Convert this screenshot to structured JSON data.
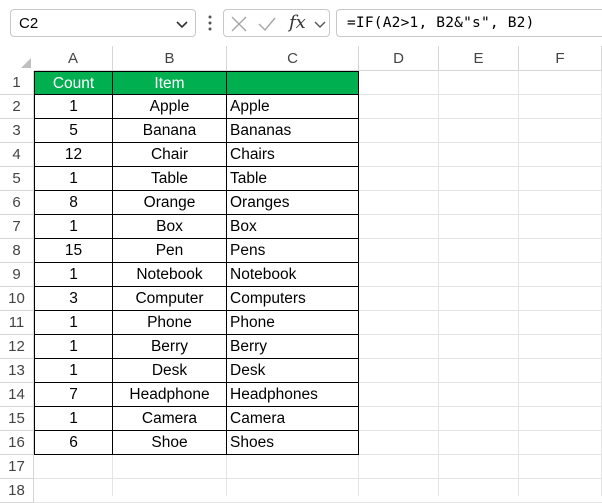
{
  "formula_bar": {
    "name_box": "C2",
    "fx_label": "fx",
    "formula": "=IF(A2>1, B2&\"s\", B2)",
    "icons": [
      "chevron-down-icon",
      "more-options-icon",
      "cancel-icon",
      "enter-icon",
      "function-icon"
    ]
  },
  "columns": [
    "A",
    "B",
    "C",
    "D",
    "E",
    "F"
  ],
  "rows": [
    "1",
    "2",
    "3",
    "4",
    "5",
    "6",
    "7",
    "8",
    "9",
    "10",
    "11",
    "12",
    "13",
    "14",
    "15",
    "16",
    "17",
    "18"
  ],
  "table": {
    "header": [
      "Count",
      "Item",
      ""
    ],
    "header_fill": "#00b050",
    "header_text_color": "#ffffff",
    "rows": [
      [
        "1",
        "Apple",
        "Apple"
      ],
      [
        "5",
        "Banana",
        "Bananas"
      ],
      [
        "12",
        "Chair",
        "Chairs"
      ],
      [
        "1",
        "Table",
        "Table"
      ],
      [
        "8",
        "Orange",
        "Oranges"
      ],
      [
        "1",
        "Box",
        "Box"
      ],
      [
        "15",
        "Pen",
        "Pens"
      ],
      [
        "1",
        "Notebook",
        "Notebook"
      ],
      [
        "3",
        "Computer",
        "Computers"
      ],
      [
        "1",
        "Phone",
        "Phone"
      ],
      [
        "1",
        "Berry",
        "Berry"
      ],
      [
        "1",
        "Desk",
        "Desk"
      ],
      [
        "7",
        "Headphone",
        "Headphones"
      ],
      [
        "1",
        "Camera",
        "Camera"
      ],
      [
        "6",
        "Shoe",
        "Shoes"
      ]
    ]
  }
}
